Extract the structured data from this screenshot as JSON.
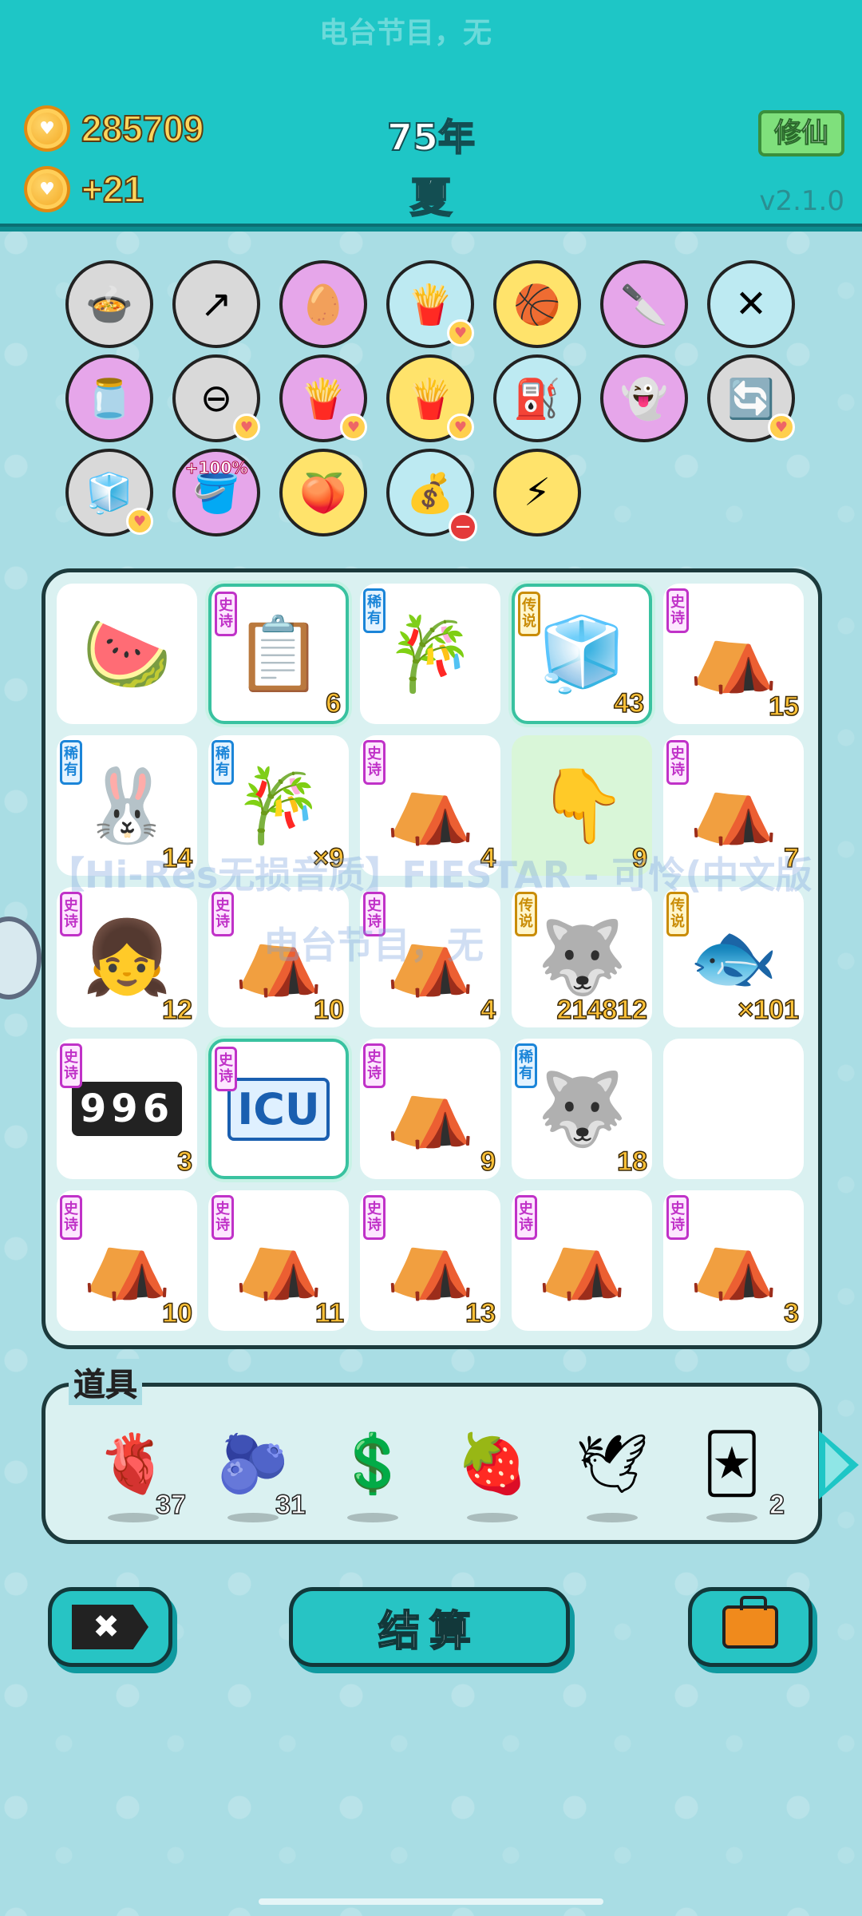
{
  "header": {
    "marquee_top": "电台节目，无",
    "coins": "285709",
    "coins_delta": "+21",
    "year": "75年",
    "season": "夏",
    "xiuxian_label": "修仙",
    "version": "v2.1.0"
  },
  "skills": [
    {
      "icon": "duck-pot-icon",
      "glyph": "🍲",
      "bg": "#d9d9d9"
    },
    {
      "icon": "upgrade-arrow-icon",
      "glyph": "↗",
      "bg": "#d9d9d9"
    },
    {
      "icon": "egg-icon",
      "glyph": "🥚",
      "bg": "#e6a6ea"
    },
    {
      "icon": "fries-icon",
      "glyph": "🍟",
      "bg": "#bdeaf2",
      "heart": true
    },
    {
      "icon": "basketballs-icon",
      "glyph": "🏀",
      "bg": "#ffe36b"
    },
    {
      "icon": "cleaver-icon",
      "glyph": "🔪",
      "bg": "#e6a6ea"
    },
    {
      "icon": "chopsticks-icon",
      "glyph": "✕",
      "bg": "#bdeaf2"
    },
    {
      "icon": "jar-icon",
      "glyph": "🫙",
      "bg": "#e6a6ea"
    },
    {
      "icon": "remove-icon",
      "glyph": "⊖",
      "bg": "#d9d9d9",
      "heart": true
    },
    {
      "icon": "fries-icon",
      "glyph": "🍟",
      "bg": "#e6a6ea",
      "heart": true
    },
    {
      "icon": "fries-icon",
      "glyph": "🍟",
      "bg": "#ffe36b",
      "heart": true
    },
    {
      "icon": "pump-icon",
      "glyph": "⛽",
      "bg": "#bdeaf2"
    },
    {
      "icon": "ghost-icon",
      "glyph": "👻",
      "bg": "#e6a6ea"
    },
    {
      "icon": "refresh-icon",
      "glyph": "🔄",
      "bg": "#d9d9d9",
      "heart": true
    },
    {
      "icon": "cubes-icon",
      "glyph": "🧊",
      "bg": "#d9d9d9",
      "heart": true
    },
    {
      "icon": "bucket-icon",
      "glyph": "🪣",
      "bg": "#e6a6ea",
      "pct": "+100%"
    },
    {
      "icon": "eyepatch-icon",
      "glyph": "🍑",
      "bg": "#ffe36b"
    },
    {
      "icon": "sack-icon",
      "glyph": "💰",
      "bg": "#bdeaf2",
      "minus": true
    },
    {
      "icon": "lightning-icon",
      "glyph": "⚡",
      "bg": "#ffe36b"
    }
  ],
  "tags": {
    "epic": [
      "史",
      "诗"
    ],
    "rare": [
      "稀",
      "有"
    ],
    "legend": [
      "传",
      "说"
    ]
  },
  "board": [
    {
      "icon": "watermelon-icon",
      "glyph": "🍉",
      "tag": null,
      "count": ""
    },
    {
      "icon": "ctrl-cv-icon",
      "glyph": "📋",
      "tag": "epic",
      "count": "6",
      "hl": true
    },
    {
      "icon": "bamboo-icon",
      "glyph": "🎋",
      "tag": "rare",
      "count": ""
    },
    {
      "icon": "fridge-icon",
      "glyph": "🧊",
      "tag": "legend",
      "count": "43",
      "hl": true
    },
    {
      "icon": "rabbit-tent-icon",
      "glyph": "⛺",
      "tag": "epic",
      "count": "15"
    },
    {
      "icon": "rabbit-icon",
      "glyph": "🐰",
      "tag": "rare",
      "count": "14"
    },
    {
      "icon": "bamboo-icon",
      "glyph": "🎋",
      "tag": "rare",
      "count": "×9"
    },
    {
      "icon": "rabbit-tent-icon",
      "glyph": "⛺",
      "tag": "epic",
      "count": "4"
    },
    {
      "icon": "pointing-hand-icon",
      "glyph": "👇",
      "tag": null,
      "count": "9",
      "green": true
    },
    {
      "icon": "rabbit-tent-icon",
      "glyph": "⛺",
      "tag": "epic",
      "count": "7"
    },
    {
      "icon": "girl-icon",
      "glyph": "👧",
      "tag": "epic",
      "count": "12"
    },
    {
      "icon": "rabbit-tent-icon",
      "glyph": "⛺",
      "tag": "epic",
      "count": "10"
    },
    {
      "icon": "rabbit-tent-icon",
      "glyph": "⛺",
      "tag": "epic",
      "count": "4"
    },
    {
      "icon": "crowned-husky-icon",
      "glyph": "🐺",
      "tag": "legend",
      "count": "214812"
    },
    {
      "icon": "koi-fish-icon",
      "glyph": "🐟",
      "tag": "legend",
      "count": "×101"
    },
    {
      "icon": "996-icon",
      "glyph": "996",
      "tag": "epic",
      "count": "3"
    },
    {
      "icon": "icu-icon",
      "glyph": "ICU",
      "tag": "epic",
      "count": "",
      "hl": true
    },
    {
      "icon": "rabbit-tent-icon",
      "glyph": "⛺",
      "tag": "epic",
      "count": "9"
    },
    {
      "icon": "husky-icon",
      "glyph": "🐺",
      "tag": "rare",
      "count": "18"
    },
    {
      "icon": "empty-slot",
      "glyph": "",
      "tag": null,
      "count": ""
    },
    {
      "icon": "rabbit-tent-icon",
      "glyph": "⛺",
      "tag": "epic",
      "count": "10"
    },
    {
      "icon": "rabbit-tent-icon",
      "glyph": "⛺",
      "tag": "epic",
      "count": "11"
    },
    {
      "icon": "rabbit-tent-icon",
      "glyph": "⛺",
      "tag": "epic",
      "count": "13"
    },
    {
      "icon": "rabbit-tent-icon",
      "glyph": "⛺",
      "tag": "epic",
      "count": ""
    },
    {
      "icon": "rabbit-tent-icon",
      "glyph": "⛺",
      "tag": "epic",
      "count": "3"
    }
  ],
  "watermark": {
    "line1": "【Hi-Res无损音质】FIESTAR - 可怜(中文版",
    "line2": "电台节目，无"
  },
  "items": {
    "title": "道具",
    "list": [
      {
        "icon": "liver-icon",
        "glyph": "🫀",
        "count": "37"
      },
      {
        "icon": "blueberry-icon",
        "glyph": "🫐",
        "count": "31"
      },
      {
        "icon": "dollar-coin-icon",
        "glyph": "💲",
        "count": ""
      },
      {
        "icon": "strawberry-icon",
        "glyph": "🍓",
        "count": ""
      },
      {
        "icon": "dove-icon",
        "glyph": "🕊",
        "count": ""
      },
      {
        "icon": "rare-cards-icon",
        "glyph": "🃏",
        "count": "2"
      }
    ]
  },
  "buttons": {
    "close": "✖",
    "settle": "结算"
  }
}
